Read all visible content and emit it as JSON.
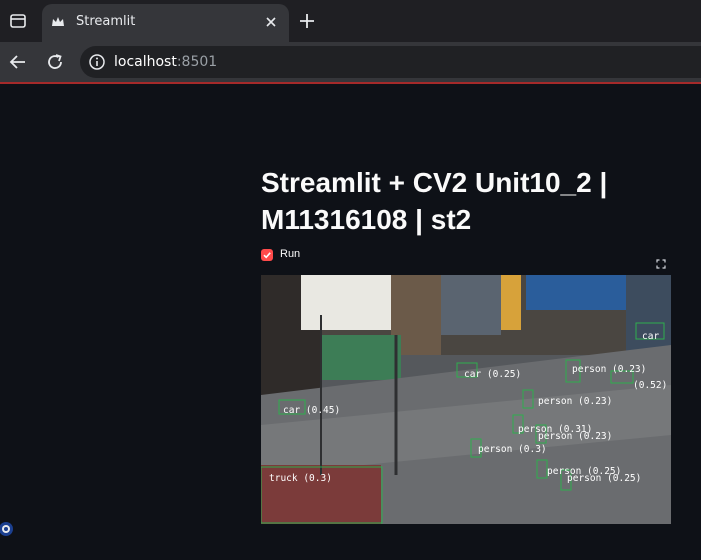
{
  "browser": {
    "tab_title": "Streamlit",
    "url_host": "localhost",
    "url_port": ":8501"
  },
  "app": {
    "title": "Streamlit + CV2 Unit10_2 | M11316108 | st2",
    "run_label": "Run",
    "run_checked": true,
    "accent": "#ff4b4b"
  },
  "detections": [
    {
      "label": "car (0.25)"
    },
    {
      "label": "car (0.45)"
    },
    {
      "label": "person (0.23)"
    },
    {
      "label": "(0.52)"
    },
    {
      "label": "car"
    },
    {
      "label": "person (0.23)"
    },
    {
      "label": "person (0.31)"
    },
    {
      "label": "person (0.23)"
    },
    {
      "label": "person (0.3)"
    },
    {
      "label": "person (0.25)"
    },
    {
      "label": "person (0.25)"
    },
    {
      "label": "truck (0.3)"
    }
  ],
  "icons": {
    "tab_toggle": "tab-strip-icon",
    "favicon": "streamlit-crown-icon",
    "close": "close-icon",
    "new_tab": "plus-icon",
    "back": "back-arrow-icon",
    "reload": "reload-icon",
    "site_info": "info-icon",
    "fullscreen": "fullscreen-icon"
  }
}
